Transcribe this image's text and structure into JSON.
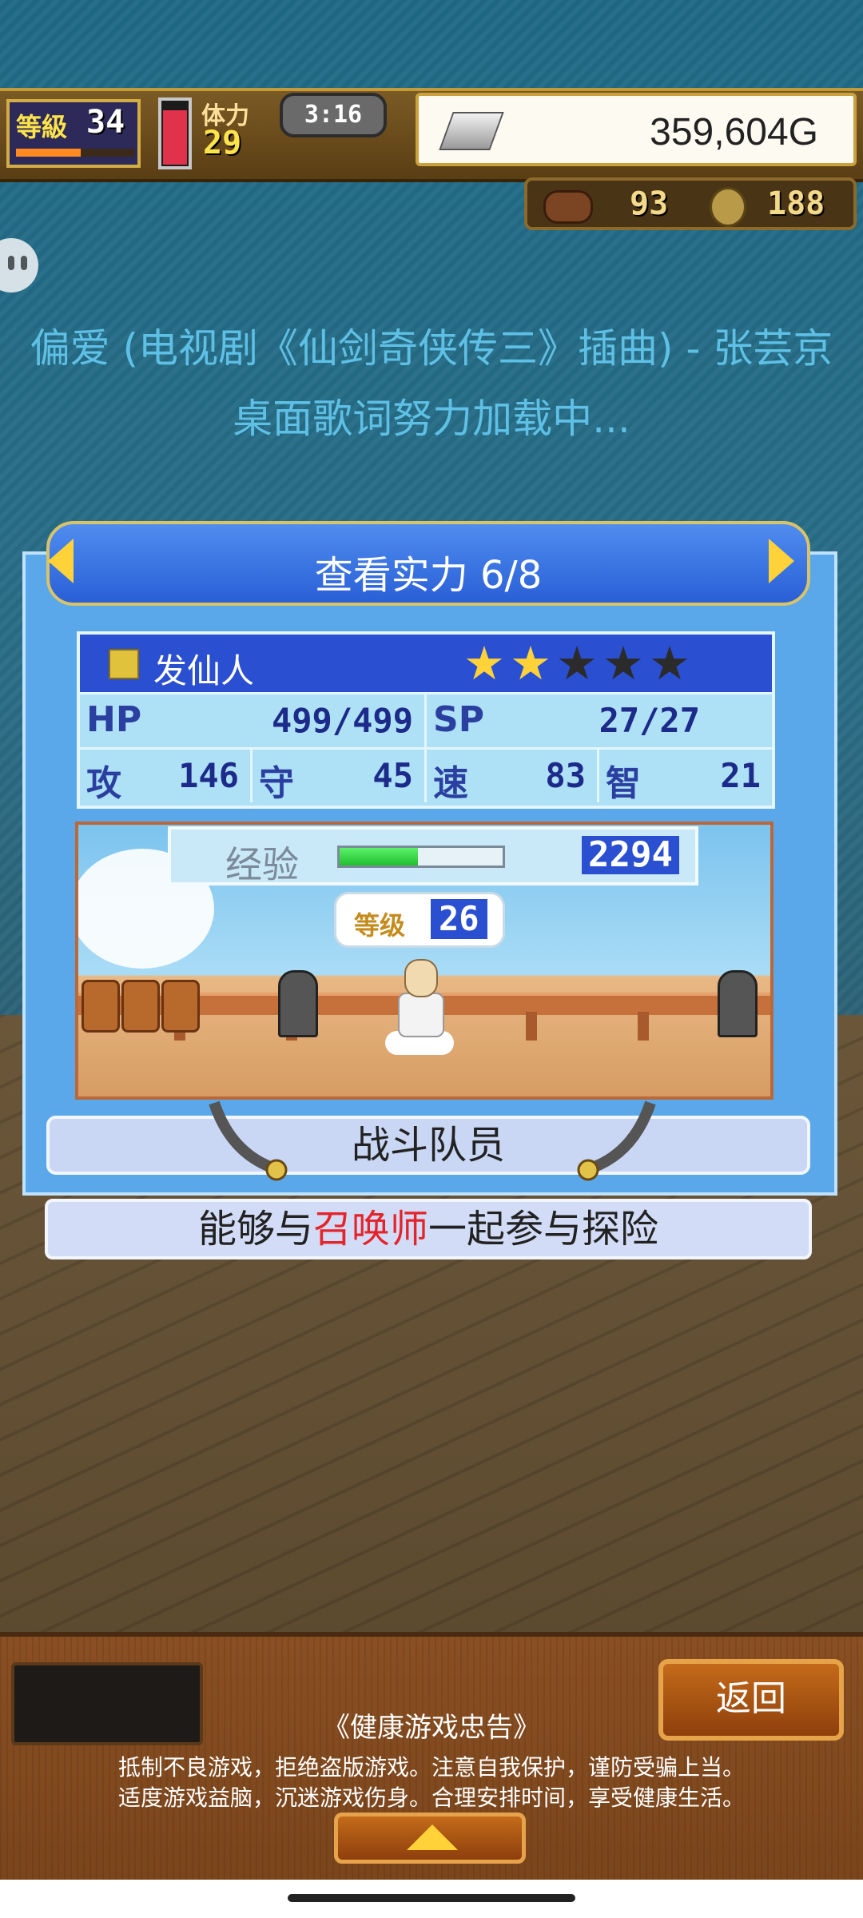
{
  "hud": {
    "level_label": "等級",
    "level_value": "34",
    "level_progress": 0.55,
    "stamina_label": "体力",
    "stamina_value": "29",
    "stamina_level": 0.9,
    "clock": "3:16",
    "gold": "359,604G",
    "resource_food": "93",
    "resource_coin": "188"
  },
  "lyrics": {
    "line1": "偏爱 (电视剧《仙剑奇侠传三》插曲) - 张芸京",
    "line2": "桌面歌词努力加载中..."
  },
  "dialog": {
    "title": "查看实力 6/8",
    "character": {
      "name": "发仙人",
      "stars_filled": 2,
      "stars_total": 5
    },
    "stats": {
      "hp_label": "HP",
      "hp_value": "499/499",
      "sp_label": "SP",
      "sp_value": "27/27",
      "atk_label": "攻",
      "atk_value": "146",
      "def_label": "守",
      "def_value": "45",
      "spd_label": "速",
      "spd_value": "83",
      "int_label": "智",
      "int_value": "21"
    },
    "exp_label": "经验",
    "exp_value": "2294",
    "exp_progress": 0.48,
    "level_label": "等级",
    "level_value": "26",
    "role": "战斗队员",
    "desc_before": "能够与",
    "desc_highlight": "召唤师",
    "desc_after": "一起参与探险"
  },
  "bottom": {
    "back_label": "返回",
    "notice_title": "《健康游戏忠告》",
    "notice_line1": "抵制不良游戏，拒绝盗版游戏。注意自我保护，谨防受骗上当。",
    "notice_line2": "适度游戏益脑，沉迷游戏伤身。合理安排时间，享受健康生活。"
  },
  "colors": {
    "accent_blue": "#2a4fd0",
    "gold_star": "#ffd23a",
    "highlight_red": "#e4242a"
  }
}
